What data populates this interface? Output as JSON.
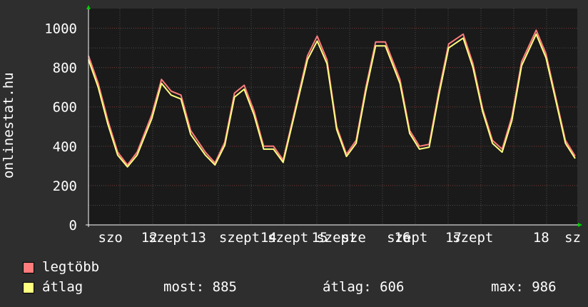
{
  "chart_data": {
    "type": "line",
    "title": "",
    "ylabel": "onlinestat.hu",
    "xlabel": "",
    "ylim": [
      0,
      1100
    ],
    "yticks": [
      0,
      200,
      400,
      600,
      800,
      1000
    ],
    "xlim": [
      0,
      1
    ],
    "grid": true,
    "xtick_labels": [
      {
        "label": "szo",
        "x": 0.045
      },
      {
        "label": "12",
        "x": 0.125
      },
      {
        "label": "szept",
        "x": 0.165
      },
      {
        "label": "13",
        "x": 0.225
      },
      {
        "label": "szept",
        "x": 0.31
      },
      {
        "label": "14",
        "x": 0.37
      },
      {
        "label": "szept",
        "x": 0.41
      },
      {
        "label": "15",
        "x": 0.475
      },
      {
        "label": "szept",
        "x": 0.51
      },
      {
        "label": "sze",
        "x": 0.545
      },
      {
        "label": "16",
        "x": 0.645
      },
      {
        "label": "szept",
        "x": 0.655
      },
      {
        "label": "17",
        "x": 0.75
      },
      {
        "label": "szept",
        "x": 0.79
      },
      {
        "label": "18",
        "x": 0.93
      },
      {
        "label": "sz",
        "x": 0.995
      }
    ],
    "series": [
      {
        "name": "legtöbb",
        "color": "#ff7c7c",
        "x": [
          0.0,
          0.02,
          0.04,
          0.06,
          0.08,
          0.1,
          0.13,
          0.15,
          0.17,
          0.19,
          0.21,
          0.24,
          0.26,
          0.28,
          0.3,
          0.32,
          0.34,
          0.36,
          0.38,
          0.4,
          0.42,
          0.45,
          0.47,
          0.49,
          0.51,
          0.53,
          0.55,
          0.57,
          0.59,
          0.61,
          0.64,
          0.66,
          0.68,
          0.7,
          0.72,
          0.74,
          0.77,
          0.79,
          0.81,
          0.83,
          0.85,
          0.87,
          0.89,
          0.92,
          0.94,
          0.96,
          0.98,
          1.0
        ],
        "y": [
          860,
          720,
          530,
          370,
          305,
          370,
          560,
          740,
          680,
          660,
          480,
          370,
          315,
          420,
          670,
          710,
          580,
          400,
          400,
          330,
          540,
          860,
          960,
          840,
          500,
          360,
          430,
          700,
          930,
          930,
          740,
          480,
          400,
          410,
          680,
          920,
          970,
          820,
          590,
          430,
          385,
          550,
          830,
          990,
          870,
          650,
          430,
          350
        ]
      },
      {
        "name": "átlag",
        "color": "#ffff80",
        "x": [
          0.0,
          0.02,
          0.04,
          0.06,
          0.08,
          0.1,
          0.13,
          0.15,
          0.17,
          0.19,
          0.21,
          0.24,
          0.26,
          0.28,
          0.3,
          0.32,
          0.34,
          0.36,
          0.38,
          0.4,
          0.42,
          0.45,
          0.47,
          0.49,
          0.51,
          0.53,
          0.55,
          0.57,
          0.59,
          0.61,
          0.64,
          0.66,
          0.68,
          0.7,
          0.72,
          0.74,
          0.77,
          0.79,
          0.81,
          0.83,
          0.85,
          0.87,
          0.89,
          0.92,
          0.94,
          0.96,
          0.98,
          1.0
        ],
        "y": [
          840,
          700,
          510,
          355,
          295,
          355,
          540,
          720,
          660,
          640,
          460,
          355,
          305,
          405,
          650,
          690,
          560,
          385,
          385,
          318,
          525,
          840,
          935,
          820,
          485,
          348,
          415,
          680,
          910,
          910,
          720,
          465,
          385,
          395,
          660,
          900,
          950,
          800,
          575,
          415,
          370,
          530,
          810,
          970,
          850,
          635,
          415,
          338
        ]
      }
    ]
  },
  "legend": {
    "items": [
      {
        "label": "legtöbb",
        "color": "#ff7c7c"
      },
      {
        "label": "átlag",
        "color": "#ffff80"
      }
    ]
  },
  "stats": {
    "most": "most: 885",
    "atlag": "átlag: 606",
    "max": "max: 986"
  }
}
